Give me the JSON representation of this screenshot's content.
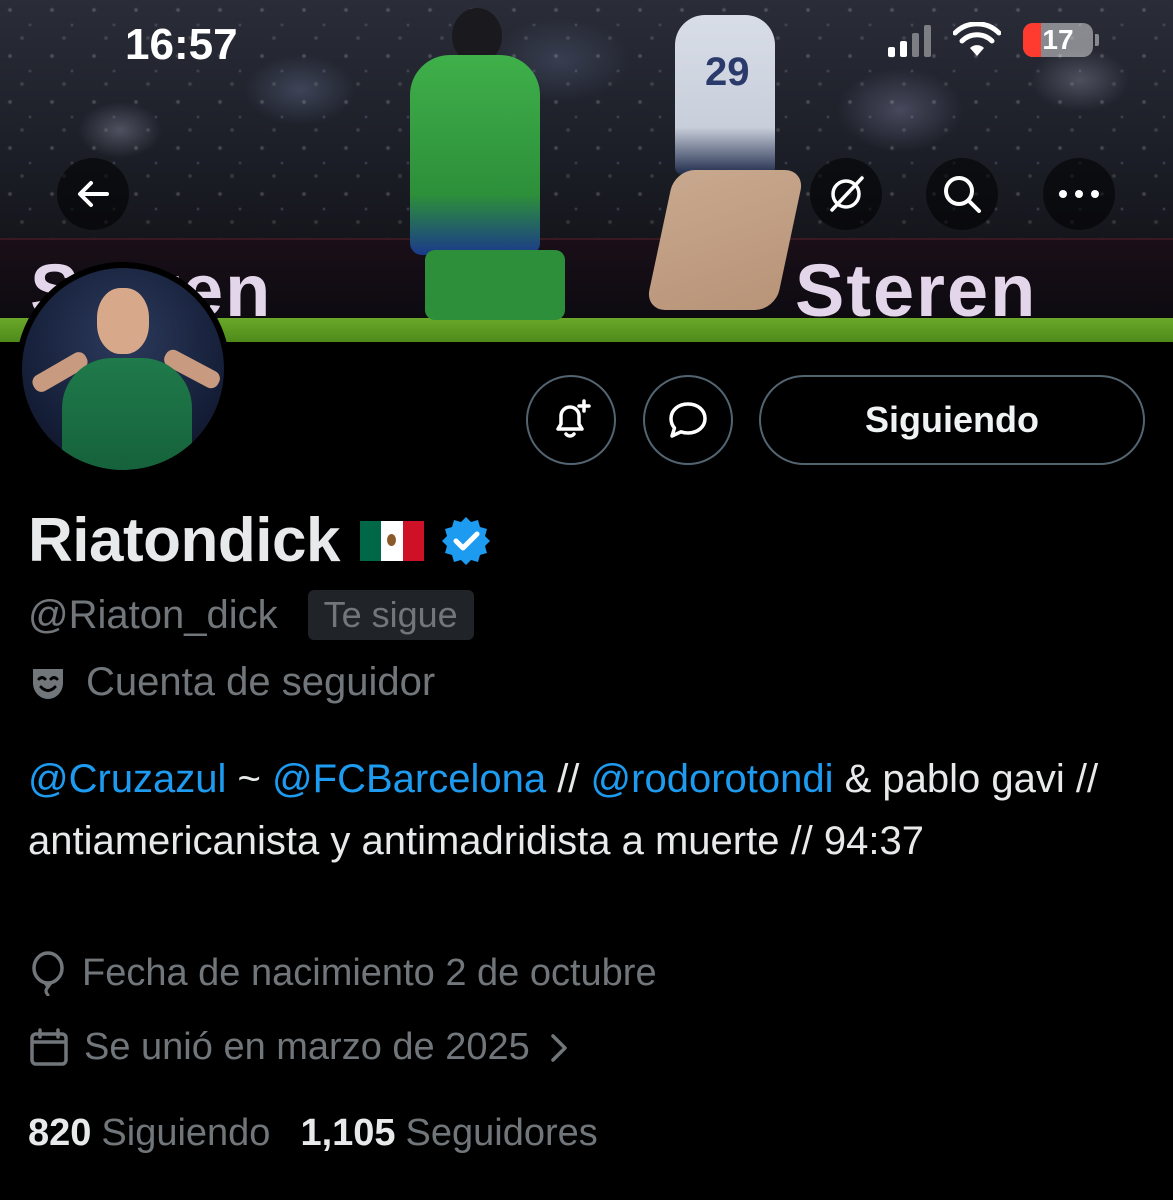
{
  "status_bar": {
    "time": "16:57",
    "battery_level": "17"
  },
  "banner": {
    "ad_text_left": "Steren",
    "ad_text_right": "Steren",
    "jersey_number": "29"
  },
  "nav": {
    "back_icon": "arrow-left-icon",
    "grok_icon": "grok-icon",
    "search_icon": "search-icon",
    "more_icon": "more-icon"
  },
  "actions": {
    "notify_icon": "bell-plus-icon",
    "message_icon": "message-icon",
    "follow_label": "Siguiendo"
  },
  "profile": {
    "display_name": "Riatondick",
    "handle": "@Riaton_dick",
    "follows_you": "Te sigue",
    "parody_label": "Cuenta de seguidor",
    "bio": {
      "mention1": "@Cruzazul",
      "sep1": " ~ ",
      "mention2": "@FCBarcelona",
      "sep2": " // ",
      "mention3": "@rodorotondi",
      "rest": " & pablo gavi // antiamericanista y antimadridista a muerte // 94:37"
    },
    "birthday": "Fecha de nacimiento 2 de octubre",
    "joined": "Se unió en marzo de 2025"
  },
  "stats": {
    "following_count": "820",
    "following_label": "Siguiendo",
    "followers_count": "1,105",
    "followers_label": "Seguidores"
  },
  "colors": {
    "accent": "#1d9bf0",
    "muted": "#71767b",
    "verified": "#1d9bf0"
  }
}
